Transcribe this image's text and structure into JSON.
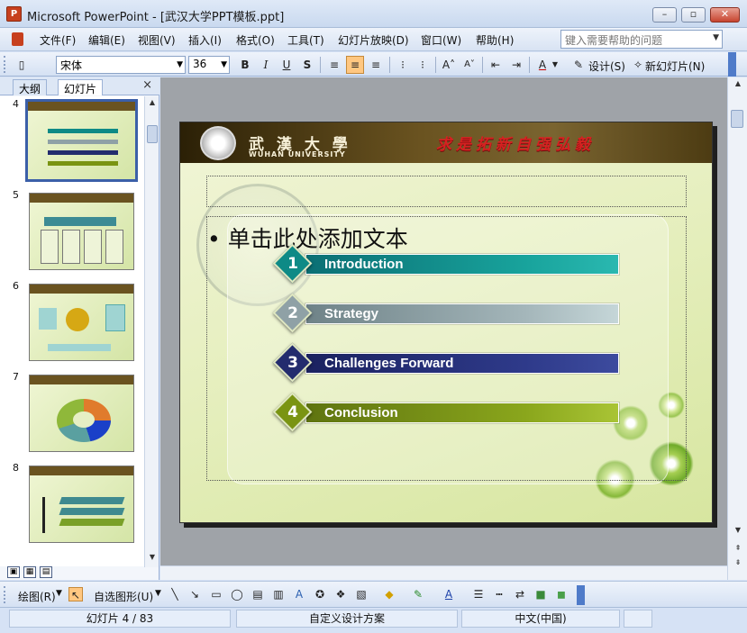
{
  "window": {
    "title": "Microsoft PowerPoint - [武汉大学PPT模板.ppt]",
    "minimize": "–",
    "restore": "▫",
    "close": "✕"
  },
  "menu": {
    "items": [
      "文件(F)",
      "编辑(E)",
      "视图(V)",
      "插入(I)",
      "格式(O)",
      "工具(T)",
      "幻灯片放映(D)",
      "窗口(W)",
      "帮助(H)"
    ],
    "help_placeholder": "键入需要帮助的问题"
  },
  "toolbar": {
    "font": "宋体",
    "size": "36",
    "bold": "B",
    "italic": "I",
    "underline": "U",
    "shadow": "S",
    "design": "设计(S)",
    "new_slide": "新幻灯片(N)"
  },
  "outline_pane": {
    "tab_outline": "大纲",
    "tab_slides": "幻灯片",
    "close": "×",
    "thumbnails": [
      {
        "number": "4",
        "current": true
      },
      {
        "number": "5",
        "current": false
      },
      {
        "number": "6",
        "current": false
      },
      {
        "number": "7",
        "current": false
      },
      {
        "number": "8",
        "current": false
      }
    ]
  },
  "slide": {
    "university_cn": "武 漢 大 學",
    "university_en": "WUHAN UNIVERSITY",
    "motto": "求是拓新自强弘毅",
    "placeholder_text": "单击此处添加文本",
    "agenda": [
      {
        "number": "1",
        "label": "Introduction",
        "color": "#0e8a86"
      },
      {
        "number": "2",
        "label": "Strategy",
        "color": "#8fa1a6"
      },
      {
        "number": "3",
        "label": "Challenges Forward",
        "color": "#232c6e"
      },
      {
        "number": "4",
        "label": "Conclusion",
        "color": "#7a9412"
      }
    ]
  },
  "drawing": {
    "draw": "绘图(R)",
    "autoshapes": "自选图形(U)"
  },
  "status": {
    "slide_pos": "幻灯片 4 / 83",
    "design": "自定义设计方案",
    "language": "中文(中国)"
  },
  "colors": {
    "slide_header": "#6a5320",
    "motto_red": "#d62121",
    "accent_orange": "#ffc781"
  }
}
